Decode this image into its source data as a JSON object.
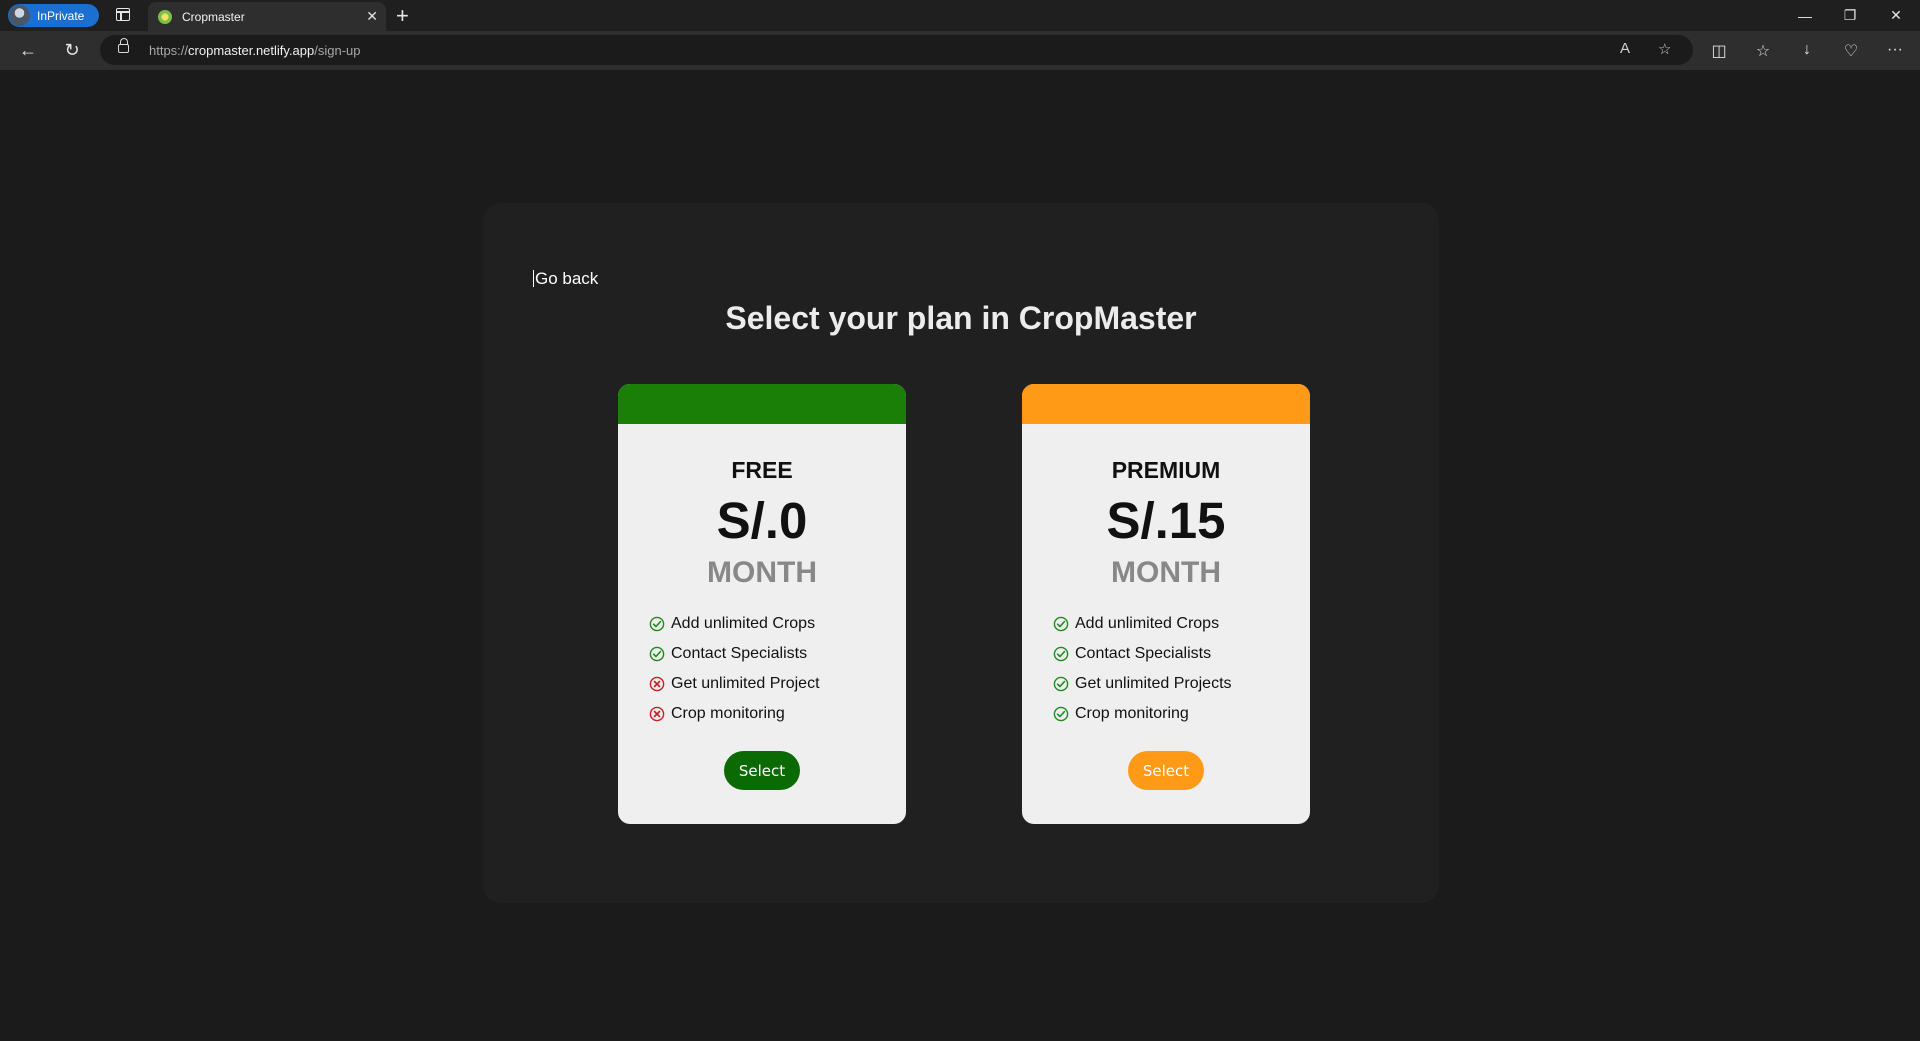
{
  "browser": {
    "inprivate_label": "InPrivate",
    "tab_title": "Cropmaster",
    "url_scheme": "https://",
    "url_host": "cropmaster.netlify.app",
    "url_path": "/sign-up"
  },
  "page": {
    "go_back": "Go back",
    "title": "Select your plan in CropMaster"
  },
  "plans": [
    {
      "name": "FREE",
      "price": "S/.0",
      "period": "MONTH",
      "accent": "#1a7f06",
      "button_color": "#0c6a04",
      "select_label": "Select",
      "features": [
        {
          "label": "Add unlimited Crops",
          "included": true
        },
        {
          "label": "Contact Specialists",
          "included": true
        },
        {
          "label": "Get unlimited Project",
          "included": false
        },
        {
          "label": "Crop monitoring",
          "included": false
        }
      ]
    },
    {
      "name": "PREMIUM",
      "price": "S/.15",
      "period": "MONTH",
      "accent": "#ff9a17",
      "button_color": "#ff9a17",
      "select_label": "Select",
      "features": [
        {
          "label": "Add unlimited Crops",
          "included": true
        },
        {
          "label": "Contact Specialists",
          "included": true
        },
        {
          "label": "Get unlimited Projects",
          "included": true
        },
        {
          "label": "Crop monitoring",
          "included": true
        }
      ]
    }
  ],
  "icons": {
    "included": "check-circle-icon",
    "excluded": "x-circle-icon",
    "included_color": "#1e8a1e",
    "excluded_color": "#c81e1e"
  }
}
